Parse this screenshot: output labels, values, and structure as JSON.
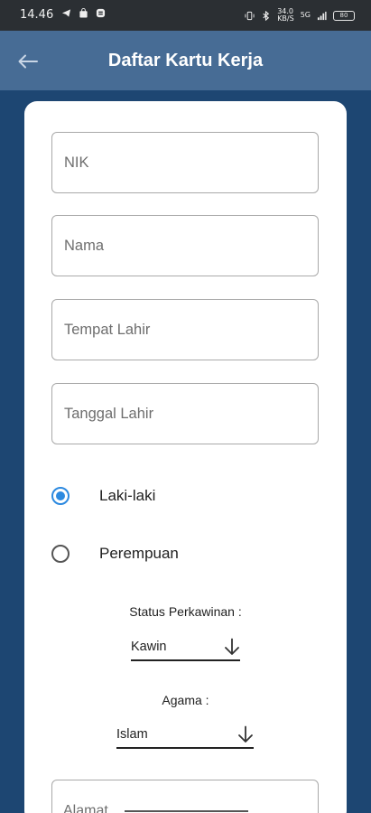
{
  "status_bar": {
    "time": "14.46",
    "signal_text": "5G",
    "battery": "80"
  },
  "app_bar": {
    "title": "Daftar Kartu Kerja"
  },
  "form": {
    "nik_placeholder": "NIK",
    "nama_placeholder": "Nama",
    "tempat_lahir_placeholder": "Tempat Lahir",
    "tanggal_lahir_placeholder": "Tanggal Lahir",
    "gender_options": [
      {
        "label": "Laki-laki",
        "selected": true
      },
      {
        "label": "Perempuan",
        "selected": false
      }
    ],
    "status_perkawinan_label": "Status Perkawinan :",
    "status_perkawinan_value": "Kawin",
    "agama_label": "Agama :",
    "agama_value": "Islam",
    "alamat_label": "Alamat"
  },
  "colors": {
    "background": "#1d4672",
    "app_bar": "#476c95",
    "status_bar": "#2b2f33",
    "radio_accent": "#2d8ae0"
  },
  "icons": [
    "telegram-icon",
    "shopping-bag-icon",
    "app-icon",
    "vibrate-icon",
    "bluetooth-icon",
    "signal-icon",
    "battery-icon",
    "back-arrow-icon",
    "arrow-down-icon"
  ]
}
